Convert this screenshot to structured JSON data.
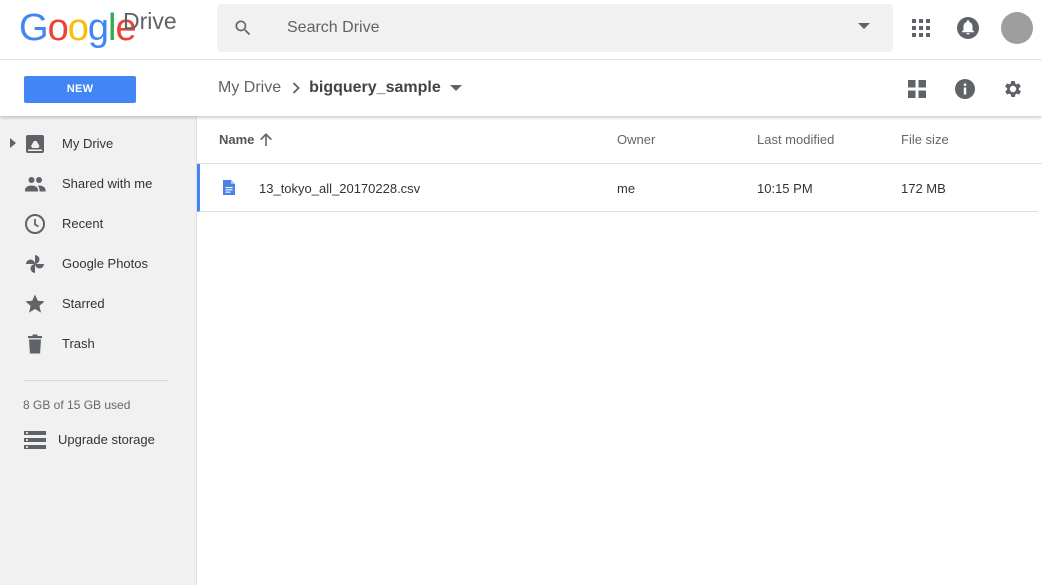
{
  "app": {
    "logo_text": "Google",
    "product_name": "Drive",
    "logo_colors": [
      "#4285f4",
      "#ea4335",
      "#fbbc05",
      "#4285f4",
      "#34a853",
      "#ea4335"
    ]
  },
  "search": {
    "placeholder": "Search Drive",
    "value": "",
    "icons": [
      "search-icon",
      "dropdown-arrow-icon"
    ]
  },
  "header_icons": [
    "apps-grid-icon",
    "notifications-bell-icon",
    "account-avatar"
  ],
  "actionbar": {
    "new_label": "NEW",
    "new_color": "#4285f4",
    "breadcrumb": {
      "root": "My Drive",
      "current": "bigquery_sample"
    },
    "icons": [
      "grid-view-icon",
      "info-icon",
      "settings-gear-icon"
    ]
  },
  "sidebar": {
    "items": [
      {
        "label": "My Drive",
        "icon": "my-drive-icon",
        "expandable": true
      },
      {
        "label": "Shared with me",
        "icon": "people-icon"
      },
      {
        "label": "Recent",
        "icon": "clock-icon"
      },
      {
        "label": "Google Photos",
        "icon": "pinwheel-icon"
      },
      {
        "label": "Starred",
        "icon": "star-icon"
      },
      {
        "label": "Trash",
        "icon": "trash-icon"
      }
    ],
    "storage_text": "8 GB of 15 GB used",
    "upgrade_label": "Upgrade storage"
  },
  "file_list": {
    "columns": {
      "name": "Name",
      "owner": "Owner",
      "modified": "Last modified",
      "size": "File size"
    },
    "sort": {
      "column": "name",
      "direction": "ascending"
    },
    "rows": [
      {
        "name": "13_tokyo_all_20170228.csv",
        "owner": "me",
        "modified": "10:15 PM",
        "size": "172 MB",
        "icon": "document-file-icon",
        "selected": true
      }
    ]
  }
}
